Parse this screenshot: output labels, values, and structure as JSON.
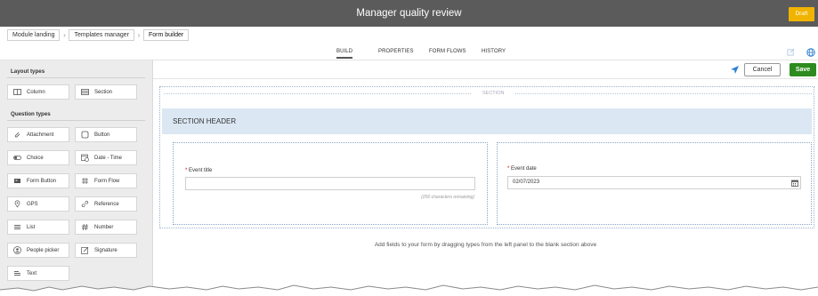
{
  "app": {
    "title": "Manager quality review",
    "status_badge": "Draft",
    "status_color": "#f0b400"
  },
  "breadcrumb": [
    "Module landing",
    "Templates manager",
    "Form builder"
  ],
  "tabs": [
    {
      "label": "BUILD",
      "active": true
    },
    {
      "label": "PROPERTIES",
      "active": false
    },
    {
      "label": "FORM FLOWS",
      "active": false
    },
    {
      "label": "HISTORY",
      "active": false
    }
  ],
  "actions": {
    "cancel_label": "Cancel",
    "save_label": "Save",
    "save_color": "#2e8b1f"
  },
  "left_panel": {
    "layout_heading": "Layout types",
    "layout_items": [
      {
        "label": "Column",
        "icon": "column-icon"
      },
      {
        "label": "Section",
        "icon": "section-icon"
      }
    ],
    "question_heading": "Question types",
    "question_items": [
      {
        "label": "Attachment",
        "icon": "paperclip-icon"
      },
      {
        "label": "Button",
        "icon": "button-icon"
      },
      {
        "label": "Choice",
        "icon": "toggle-icon"
      },
      {
        "label": "Date - Time",
        "icon": "calendar-clock-icon"
      },
      {
        "label": "Form Button",
        "icon": "form-button-icon"
      },
      {
        "label": "Form Flow",
        "icon": "form-flow-icon"
      },
      {
        "label": "GPS",
        "icon": "location-pin-icon"
      },
      {
        "label": "Reference",
        "icon": "link-icon"
      },
      {
        "label": "List",
        "icon": "list-icon"
      },
      {
        "label": "Number",
        "icon": "hash-icon"
      },
      {
        "label": "People picker",
        "icon": "person-icon"
      },
      {
        "label": "Signature",
        "icon": "signature-icon"
      },
      {
        "label": "Text",
        "icon": "text-icon"
      }
    ]
  },
  "canvas": {
    "section_tag": "SECTION",
    "section_header": "SECTION HEADER",
    "fields": [
      {
        "label": "Event title",
        "required": "*",
        "value": "",
        "help": "(250 characters remaining)"
      },
      {
        "label": "Event date",
        "required": "*",
        "value": "02/07/2023"
      }
    ],
    "hint": "Add fields to your form by dragging types from the left panel to the blank section above"
  }
}
